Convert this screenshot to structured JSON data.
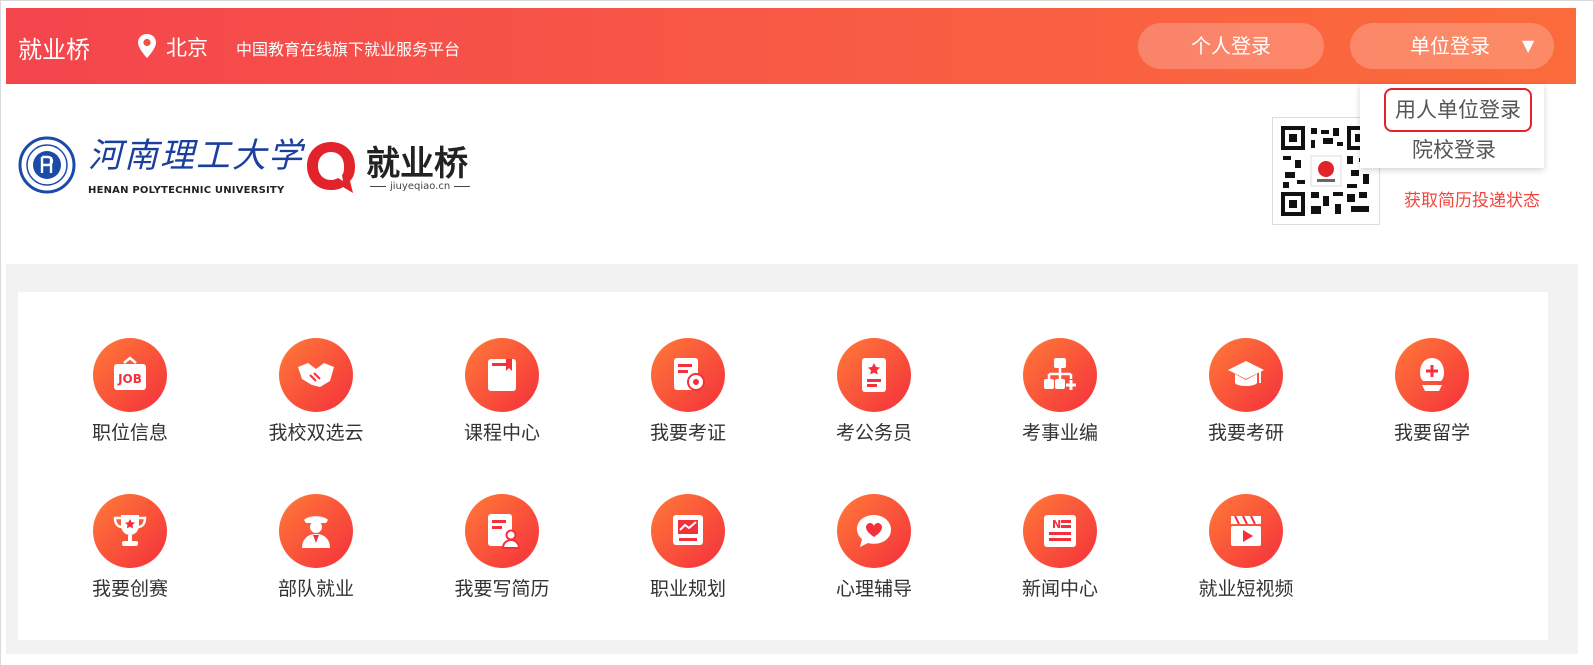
{
  "topbar": {
    "brand": "就业桥",
    "location": "北京",
    "slogan": "中国教育在线旗下就业服务平台",
    "personal_login": "个人登录",
    "org_login": "单位登录",
    "caret": "▼"
  },
  "dropdown": {
    "items": [
      "用人单位登录",
      "院校登录"
    ]
  },
  "logos": {
    "university_cn": "河南理工大学",
    "university_en": "HENAN POLYTECHNIC UNIVERSITY",
    "jyq_name": "就业桥",
    "jyq_domain": "jiuyeqiao.cn"
  },
  "aside": {
    "resume_status": "获取简历投递状态"
  },
  "services": [
    {
      "label": "职位信息",
      "icon": "job-board-icon"
    },
    {
      "label": "我校双选云",
      "icon": "handshake-icon"
    },
    {
      "label": "课程中心",
      "icon": "book-icon"
    },
    {
      "label": "我要考证",
      "icon": "certificate-icon"
    },
    {
      "label": "考公务员",
      "icon": "civil-exam-icon"
    },
    {
      "label": "考事业编",
      "icon": "org-chart-icon"
    },
    {
      "label": "我要考研",
      "icon": "graduation-cap-icon"
    },
    {
      "label": "我要留学",
      "icon": "travel-icon"
    },
    {
      "label": "我要创赛",
      "icon": "trophy-icon"
    },
    {
      "label": "部队就业",
      "icon": "soldier-icon"
    },
    {
      "label": "我要写简历",
      "icon": "resume-icon"
    },
    {
      "label": "职业规划",
      "icon": "chart-board-icon"
    },
    {
      "label": "心理辅导",
      "icon": "heart-chat-icon"
    },
    {
      "label": "新闻中心",
      "icon": "news-icon"
    },
    {
      "label": "就业短视频",
      "icon": "video-clapper-icon"
    }
  ],
  "colors": {
    "topbar_start": "#f4454d",
    "topbar_end": "#fb6b3b",
    "accent_red": "#e3232b",
    "icon_orange": "#ff7a38",
    "icon_red": "#f4303c"
  }
}
